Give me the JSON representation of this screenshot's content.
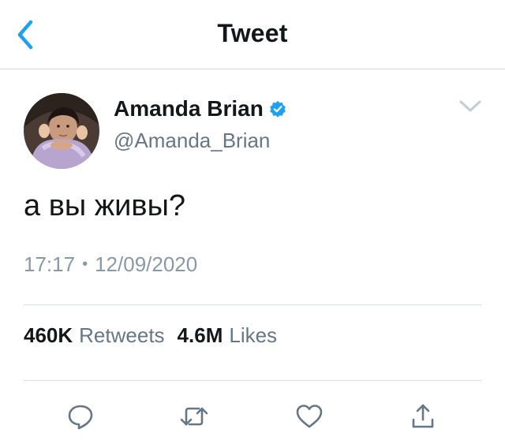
{
  "header": {
    "title": "Tweet",
    "back_icon": "chevron-left-icon"
  },
  "tweet": {
    "author": {
      "display_name": "Amanda Brian",
      "handle": "@Amanda_Brian",
      "verified": true
    },
    "text": "а вы живы?",
    "time": "17:17",
    "separator": "•",
    "date": "12/09/2020",
    "stats": {
      "retweets_count": "460K",
      "retweets_label": "Retweets",
      "likes_count": "4.6M",
      "likes_label": "Likes"
    }
  },
  "actions": [
    {
      "name": "reply",
      "icon": "speech-bubble-icon"
    },
    {
      "name": "retweet",
      "icon": "retweet-arrows-icon"
    },
    {
      "name": "like",
      "icon": "heart-icon"
    },
    {
      "name": "share",
      "icon": "share-upload-icon"
    }
  ],
  "colors": {
    "accent": "#1da1f2",
    "text_primary": "#14171a",
    "text_secondary": "#657786",
    "icon_gray": "#657786",
    "divider": "#d7dde2"
  }
}
